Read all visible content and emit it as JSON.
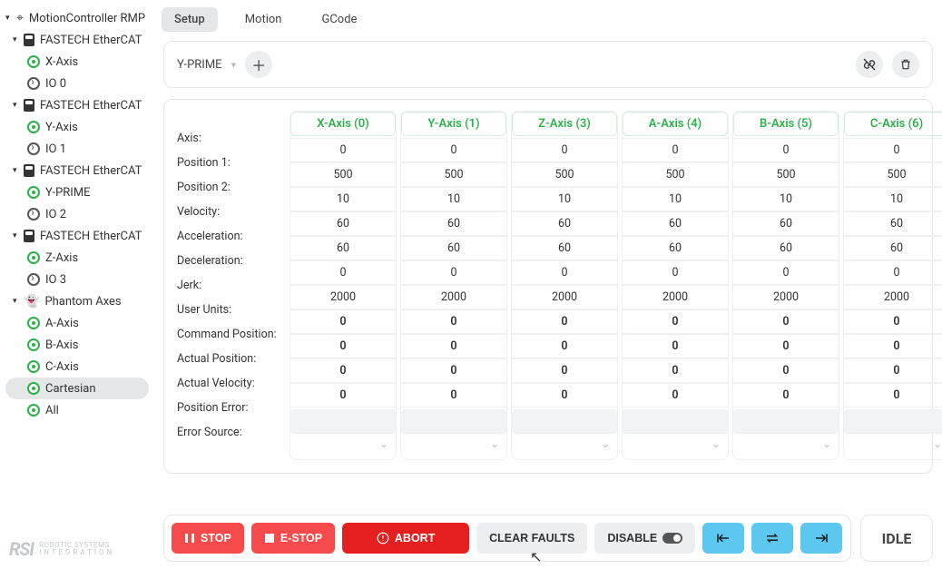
{
  "tree": {
    "root": "MotionController RMP",
    "groups": [
      {
        "label": "FASTECH EtherCAT",
        "children": [
          {
            "label": "X-Axis",
            "kind": "axis"
          },
          {
            "label": "IO 0",
            "kind": "io"
          }
        ]
      },
      {
        "label": "FASTECH EtherCAT",
        "children": [
          {
            "label": "Y-Axis",
            "kind": "axis"
          },
          {
            "label": "IO 1",
            "kind": "io"
          }
        ]
      },
      {
        "label": "FASTECH EtherCAT",
        "children": [
          {
            "label": "Y-PRIME",
            "kind": "axis"
          },
          {
            "label": "IO 2",
            "kind": "io"
          }
        ]
      },
      {
        "label": "FASTECH EtherCAT",
        "children": [
          {
            "label": "Z-Axis",
            "kind": "axis"
          },
          {
            "label": "IO 3",
            "kind": "io"
          }
        ]
      },
      {
        "label": "Phantom Axes",
        "kind": "ghost",
        "children": [
          {
            "label": "A-Axis",
            "kind": "axis"
          },
          {
            "label": "B-Axis",
            "kind": "axis"
          },
          {
            "label": "C-Axis",
            "kind": "axis"
          },
          {
            "label": "Cartesian",
            "kind": "axis",
            "selected": true
          },
          {
            "label": "All",
            "kind": "axis"
          }
        ]
      }
    ]
  },
  "brand": {
    "main": "RSI",
    "sub1": "ROBOTIC SYSTEMS",
    "sub2": "I N T E G R A T I O N"
  },
  "tabs": [
    "Setup",
    "Motion",
    "GCode"
  ],
  "active_tab": "Setup",
  "toolbar": {
    "name": "Y-PRIME"
  },
  "row_labels": [
    "Axis:",
    "Position 1:",
    "Position 2:",
    "Velocity:",
    "Acceleration:",
    "Deceleration:",
    "Jerk:",
    "User Units:",
    "Command Position:",
    "Actual Position:",
    "Actual Velocity:",
    "Position Error:",
    "Error Source:"
  ],
  "columns": [
    {
      "header": "X-Axis (0)",
      "position1": "0",
      "position2": "500",
      "velocity": "10",
      "acceleration": "60",
      "deceleration": "60",
      "jerk": "0",
      "userunits": "2000",
      "cmdpos": "0",
      "actpos": "0",
      "actvel": "0",
      "poserr": "0"
    },
    {
      "header": "Y-Axis (1)",
      "position1": "0",
      "position2": "500",
      "velocity": "10",
      "acceleration": "60",
      "deceleration": "60",
      "jerk": "0",
      "userunits": "2000",
      "cmdpos": "0",
      "actpos": "0",
      "actvel": "0",
      "poserr": "0"
    },
    {
      "header": "Z-Axis (3)",
      "position1": "0",
      "position2": "500",
      "velocity": "10",
      "acceleration": "60",
      "deceleration": "60",
      "jerk": "0",
      "userunits": "2000",
      "cmdpos": "0",
      "actpos": "0",
      "actvel": "0",
      "poserr": "0"
    },
    {
      "header": "A-Axis (4)",
      "position1": "0",
      "position2": "500",
      "velocity": "10",
      "acceleration": "60",
      "deceleration": "60",
      "jerk": "0",
      "userunits": "2000",
      "cmdpos": "0",
      "actpos": "0",
      "actvel": "0",
      "poserr": "0"
    },
    {
      "header": "B-Axis (5)",
      "position1": "0",
      "position2": "500",
      "velocity": "10",
      "acceleration": "60",
      "deceleration": "60",
      "jerk": "0",
      "userunits": "2000",
      "cmdpos": "0",
      "actpos": "0",
      "actvel": "0",
      "poserr": "0"
    },
    {
      "header": "C-Axis (6)",
      "position1": "0",
      "position2": "500",
      "velocity": "10",
      "acceleration": "60",
      "deceleration": "60",
      "jerk": "0",
      "userunits": "2000",
      "cmdpos": "0",
      "actpos": "0",
      "actvel": "0",
      "poserr": "0"
    }
  ],
  "buttons": {
    "stop": "STOP",
    "estop": "E-STOP",
    "abort": "ABORT",
    "clear": "CLEAR FAULTS",
    "disable": "DISABLE"
  },
  "status": "IDLE"
}
